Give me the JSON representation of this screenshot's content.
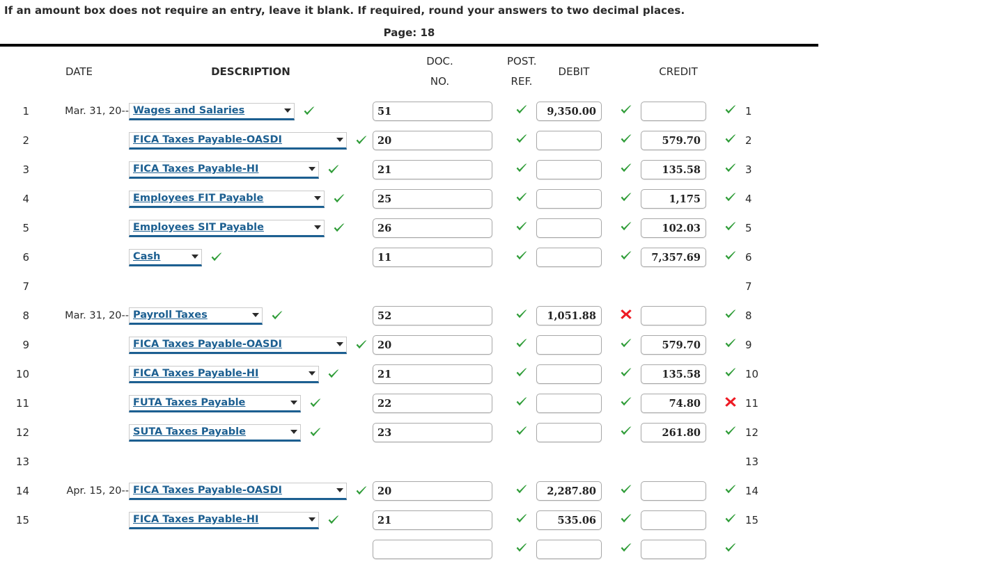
{
  "instruction": "If an amount box does not require an entry, leave it blank. If required, round your answers to two decimal places.",
  "page_label": "Page: 18",
  "colors": {
    "link_blue": "#1c5f91",
    "check_green": "#2e9c37",
    "cross_red": "#ee1b24",
    "rule_black": "#000000"
  },
  "headers": {
    "date": "DATE",
    "description": "DESCRIPTION",
    "doc_no_line1": "DOC.",
    "doc_no_line2": "NO.",
    "post_ref_line1": "POST.",
    "post_ref_line2": "REF.",
    "debit": "DEBIT",
    "credit": "CREDIT"
  },
  "icons": {
    "check": "check-icon",
    "cross": "cross-icon",
    "dropdown_arrow": "chevron-down-icon"
  },
  "rows": [
    {
      "line": "1",
      "line_right": "1",
      "date": "Mar. 31, 20--",
      "description": "Wages and Salaries",
      "desc_width": 238,
      "doc_no": "51",
      "doc_mark": "check",
      "debit": "9,350.00",
      "debit_mark": "check",
      "credit": "",
      "credit_mark": "check",
      "desc_mark": "check"
    },
    {
      "line": "2",
      "line_right": "2",
      "date": "",
      "description": "FICA Taxes Payable-OASDI",
      "desc_width": 313,
      "doc_no": "20",
      "doc_mark": "check",
      "debit": "",
      "debit_mark": "check",
      "credit": "579.70",
      "credit_mark": "check",
      "desc_mark": "check"
    },
    {
      "line": "3",
      "line_right": "3",
      "date": "",
      "description": "FICA Taxes Payable-HI",
      "desc_width": 273,
      "doc_no": "21",
      "doc_mark": "check",
      "debit": "",
      "debit_mark": "check",
      "credit": "135.58",
      "credit_mark": "check",
      "desc_mark": "check"
    },
    {
      "line": "4",
      "line_right": "4",
      "date": "",
      "description": "Employees FIT Payable",
      "desc_width": 281,
      "doc_no": "25",
      "doc_mark": "check",
      "debit": "",
      "debit_mark": "check",
      "credit": "1,175",
      "credit_mark": "check",
      "desc_mark": "check"
    },
    {
      "line": "5",
      "line_right": "5",
      "date": "",
      "description": "Employees SIT Payable",
      "desc_width": 281,
      "doc_no": "26",
      "doc_mark": "check",
      "debit": "",
      "debit_mark": "check",
      "credit": "102.03",
      "credit_mark": "check",
      "desc_mark": "check"
    },
    {
      "line": "6",
      "line_right": "6",
      "date": "",
      "description": "Cash",
      "desc_width": 105,
      "doc_no": "11",
      "doc_mark": "check",
      "debit": "",
      "debit_mark": "check",
      "credit": "7,357.69",
      "credit_mark": "check",
      "desc_mark": "check"
    },
    {
      "line": "7",
      "line_right": "7",
      "date": "",
      "description": null,
      "desc_width": 0,
      "doc_no": null,
      "doc_mark": null,
      "debit": null,
      "debit_mark": null,
      "credit": null,
      "credit_mark": null,
      "desc_mark": null
    },
    {
      "line": "8",
      "line_right": "8",
      "date": "Mar. 31, 20--",
      "description": "Payroll Taxes",
      "desc_width": 192,
      "doc_no": "52",
      "doc_mark": "check",
      "debit": "1,051.88",
      "debit_mark": "cross",
      "credit": "",
      "credit_mark": "check",
      "desc_mark": "check"
    },
    {
      "line": "9",
      "line_right": "9",
      "date": "",
      "description": "FICA Taxes Payable-OASDI",
      "desc_width": 313,
      "doc_no": "20",
      "doc_mark": "check",
      "debit": "",
      "debit_mark": "check",
      "credit": "579.70",
      "credit_mark": "check",
      "desc_mark": "check"
    },
    {
      "line": "10",
      "line_right": "10",
      "date": "",
      "description": "FICA Taxes Payable-HI",
      "desc_width": 273,
      "doc_no": "21",
      "doc_mark": "check",
      "debit": "",
      "debit_mark": "check",
      "credit": "135.58",
      "credit_mark": "check",
      "desc_mark": "check"
    },
    {
      "line": "11",
      "line_right": "11",
      "date": "",
      "description": "FUTA Taxes Payable",
      "desc_width": 247,
      "doc_no": "22",
      "doc_mark": "check",
      "debit": "",
      "debit_mark": "check",
      "credit": "74.80",
      "credit_mark": "cross",
      "desc_mark": "check"
    },
    {
      "line": "12",
      "line_right": "12",
      "date": "",
      "description": "SUTA Taxes Payable",
      "desc_width": 247,
      "doc_no": "23",
      "doc_mark": "check",
      "debit": "",
      "debit_mark": "check",
      "credit": "261.80",
      "credit_mark": "check",
      "desc_mark": "check"
    },
    {
      "line": "13",
      "line_right": "13",
      "date": "",
      "description": null,
      "desc_width": 0,
      "doc_no": null,
      "doc_mark": null,
      "debit": null,
      "debit_mark": null,
      "credit": null,
      "credit_mark": null,
      "desc_mark": null
    },
    {
      "line": "14",
      "line_right": "14",
      "date": "Apr. 15, 20--",
      "description": "FICA Taxes Payable-OASDI",
      "desc_width": 313,
      "doc_no": "20",
      "doc_mark": "check",
      "debit": "2,287.80",
      "debit_mark": "check",
      "credit": "",
      "credit_mark": "check",
      "desc_mark": "check"
    },
    {
      "line": "15",
      "line_right": "15",
      "date": "",
      "description": "FICA Taxes Payable-HI",
      "desc_width": 273,
      "doc_no": "21",
      "doc_mark": "check",
      "debit": "535.06",
      "debit_mark": "check",
      "credit": "",
      "credit_mark": "check",
      "desc_mark": "check"
    },
    {
      "line": "",
      "line_right": "",
      "date": "",
      "description": null,
      "desc_width": 0,
      "doc_no": "",
      "doc_mark": "check",
      "debit": "",
      "debit_mark": "check",
      "credit": "",
      "credit_mark": "check",
      "desc_mark": null
    }
  ]
}
